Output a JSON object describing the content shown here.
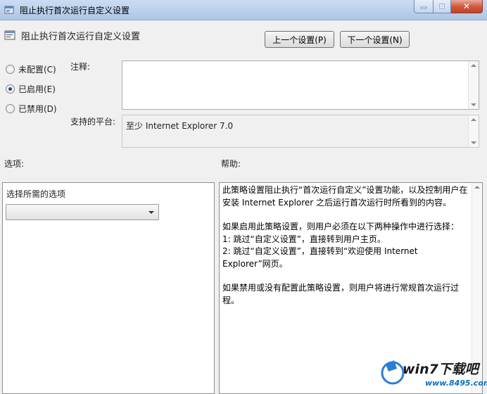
{
  "window": {
    "title": "阻止执行首次运行自定义设置"
  },
  "header": {
    "title": "阻止执行首次运行自定义设置",
    "prev_button": "上一个设置(P)",
    "next_button": "下一个设置(N)"
  },
  "state": {
    "options": [
      {
        "label": "未配置(C)",
        "checked": false
      },
      {
        "label": "已启用(E)",
        "checked": true
      },
      {
        "label": "已禁用(D)",
        "checked": false
      }
    ]
  },
  "comment": {
    "label": "注释:",
    "value": ""
  },
  "platform": {
    "label": "支持的平台:",
    "value": "至少 Internet Explorer 7.0"
  },
  "options_section": {
    "label": "选项:",
    "select_label": "选择所需的选项",
    "select_value": ""
  },
  "help_section": {
    "label": "帮助:",
    "paragraphs": [
      "此策略设置阻止执行“首次运行自定义”设置功能，以及控制用户在安装 Internet Explorer 之后运行首次运行时所看到的内容。",
      "如果启用此策略设置，则用户必须在以下两种操作中进行选择：",
      "1: 跳过“自定义设置”，直接转到用户主页。",
      "2: 跳过“自定义设置”，直接转到“欢迎使用 Internet Explorer”网页。",
      "如果禁用或没有配置此策略设置，则用户将进行常规首次运行过程。"
    ]
  },
  "watermark": {
    "brand": "win7下载吧",
    "url": "www.8495.com"
  },
  "colors": {
    "titlebar": "#b9cfea",
    "window_bg": "#f0f0f0",
    "close_button": "#c2432a",
    "radio_dot": "#1d4c8a",
    "watermark_url": "#0a6fc2"
  }
}
